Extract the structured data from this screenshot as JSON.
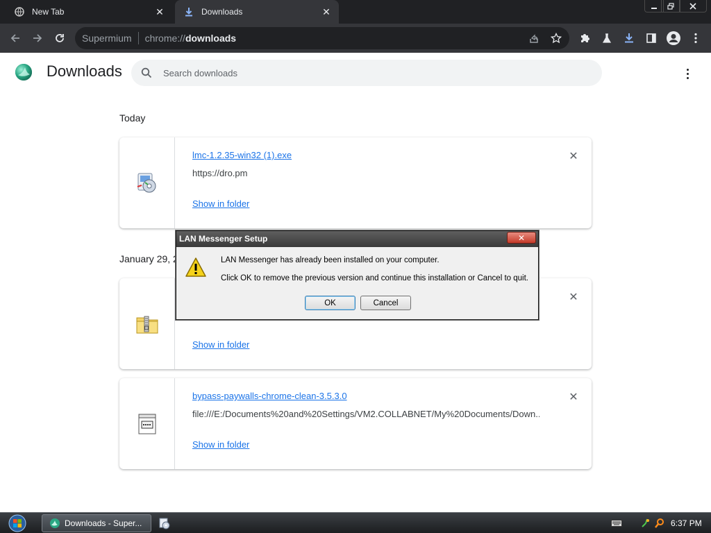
{
  "tabs": [
    {
      "label": "New Tab",
      "icon": "globe-icon"
    },
    {
      "label": "Downloads",
      "icon": "download-icon"
    }
  ],
  "omnibox": {
    "origin": "Supermium",
    "scheme": "chrome://",
    "host": "downloads"
  },
  "page": {
    "title": "Downloads",
    "search_placeholder": "Search downloads"
  },
  "sections": [
    {
      "date": "Today"
    },
    {
      "date": "January 29, 2024"
    }
  ],
  "downloads": [
    {
      "file": "lmc-1.2.35-win32 (1).exe",
      "url": "https://dro.pm",
      "action": "Show in folder",
      "icon": "installer-icon"
    },
    {
      "file": "",
      "url": "",
      "action": "Show in folder",
      "icon": "zip-folder-icon"
    },
    {
      "file": "bypass-paywalls-chrome-clean-3.5.3.0",
      "url": "file:///E:/Documents%20and%20Settings/VM2.COLLABNET/My%20Documents/Down...",
      "action": "Show in folder",
      "icon": "script-file-icon"
    }
  ],
  "dialog": {
    "title": "LAN Messenger Setup",
    "line1": "LAN Messenger has already been installed on your computer.",
    "line2": "Click OK to remove the previous version and continue this installation or Cancel to quit.",
    "ok": "OK",
    "cancel": "Cancel",
    "close_glyph": "✕"
  },
  "taskbar": {
    "item_label": "Downloads - Super...",
    "clock": "6:37 PM"
  },
  "colors": {
    "link": "#1a73e8",
    "accent": "#8ab4f8",
    "chrome_dark": "#202124"
  }
}
